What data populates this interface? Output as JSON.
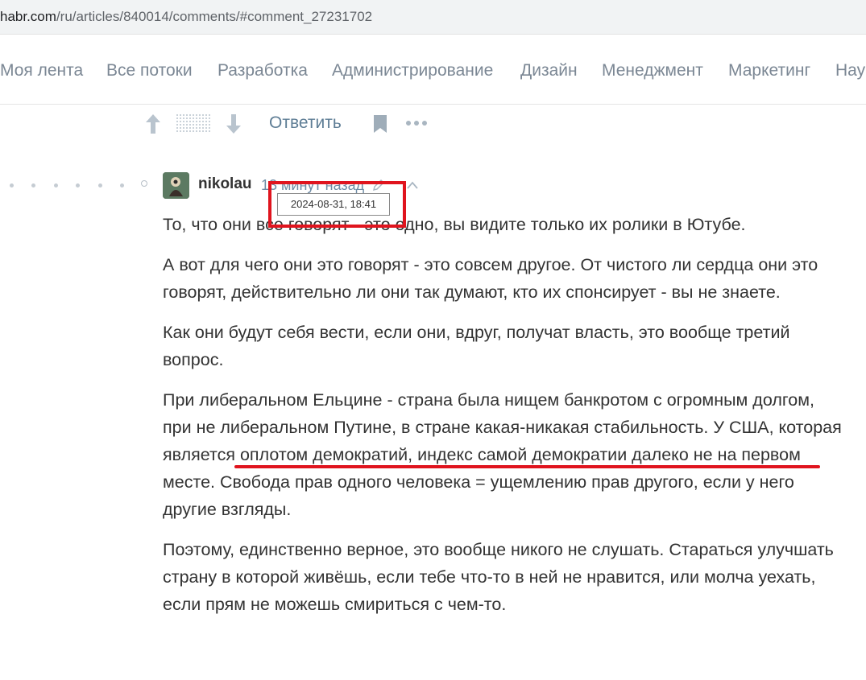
{
  "browser": {
    "url_host": "habr.com",
    "url_path": "/ru/articles/840014/comments/#comment_27231702"
  },
  "nav": {
    "items": [
      "Моя лента",
      "Все потоки",
      "Разработка",
      "Администрирование",
      "Дизайн",
      "Менеджмент",
      "Маркетинг",
      "Нау"
    ]
  },
  "actions": {
    "reply_label": "Ответить",
    "icons": [
      "arrow-up-icon",
      "score-placeholder",
      "arrow-down-icon",
      "bookmark-icon",
      "more-icon"
    ]
  },
  "comment": {
    "author": "nikolau",
    "time_ago": "13 минут назад",
    "tooltip_datetime": "2024-08-31, 18:41",
    "paragraphs": [
      "То, что они все говорят - это одно, вы видите только их ролики в Ютубе.",
      "А вот для чего они это говорят - это совсем другое. От чистого ли сердца они это говорят, действительно ли они так думают, кто их спонсирует - вы не знаете.",
      "Как они будут себя вести, если они, вдруг, получат власть, это вообще третий вопрос.",
      "При либеральном Ельцине - страна была нищем банкротом с огромным долгом, при не либеральном Путине, в стране какая-никакая стабильность. У США, которая является оплотом демократий, индекс самой демократии далеко не на первом месте. Свобода прав одного человека = ущемлению прав другого, если у него другие взгляды.",
      "Поэтому, единственно верное, это вообще никого не слушать. Стараться улучшать страну в которой живёшь, если тебе что-то в ней не нравится, или молча уехать, если прям не можешь смириться с чем-то."
    ]
  },
  "colors": {
    "annotation_red": "#e0141e",
    "link_blue": "#5e7d95",
    "nav_gray": "#7b8794"
  }
}
